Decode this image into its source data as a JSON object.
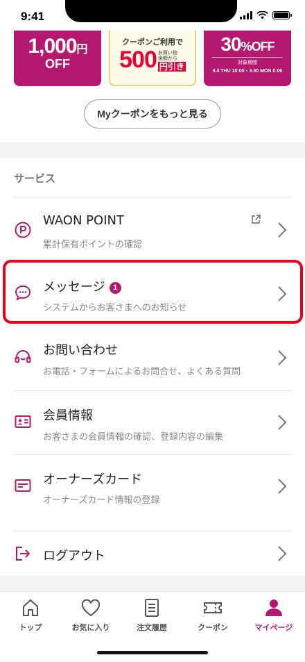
{
  "status_bar": {
    "time": "9:41"
  },
  "banners": [
    {
      "amount": "1,000",
      "unit": "円",
      "suffix": "OFF"
    },
    {
      "heading": "クーポンご利用で",
      "amount": "500",
      "note": "お買い物金額から",
      "suffix": "円引き"
    },
    {
      "amount": "30",
      "unit": "%OFF",
      "period_label": "対象期間",
      "period": "3.4 THU 10:00・3.30 MON 0:00"
    }
  ],
  "more_coupons_label": "Myクーポンをもっと見る",
  "section_title": "サービス",
  "items": [
    {
      "title": "WAON POINT",
      "sub": "累計保有ポイントの確認",
      "icon": "waon-point-icon"
    },
    {
      "title": "メッセージ",
      "badge": "1",
      "sub": "システムからお客さまへのお知らせ",
      "icon": "message-icon"
    },
    {
      "title": "お問い合わせ",
      "sub": "お電話・フォームによるお問合せ、よくある質問",
      "icon": "headset-icon"
    },
    {
      "title": "会員情報",
      "sub": "お客さまの会員情報の確認、登録内容の編集",
      "icon": "id-card-icon"
    },
    {
      "title": "オーナーズカード",
      "sub": "オーナーズカード情報の登録",
      "icon": "card-icon"
    },
    {
      "title": "ログアウト",
      "icon": "logout-icon"
    }
  ],
  "tabs": [
    {
      "label": "トップ",
      "icon": "home-icon",
      "active": false
    },
    {
      "label": "お気に入り",
      "icon": "heart-icon",
      "active": false
    },
    {
      "label": "注文履歴",
      "icon": "document-icon",
      "active": false
    },
    {
      "label": "クーポン",
      "icon": "ticket-icon",
      "active": false
    },
    {
      "label": "マイページ",
      "icon": "person-icon",
      "active": true
    }
  ],
  "colors": {
    "accent": "#b4186f",
    "highlight": "#e8001d",
    "coupon_red": "#e6003a"
  }
}
